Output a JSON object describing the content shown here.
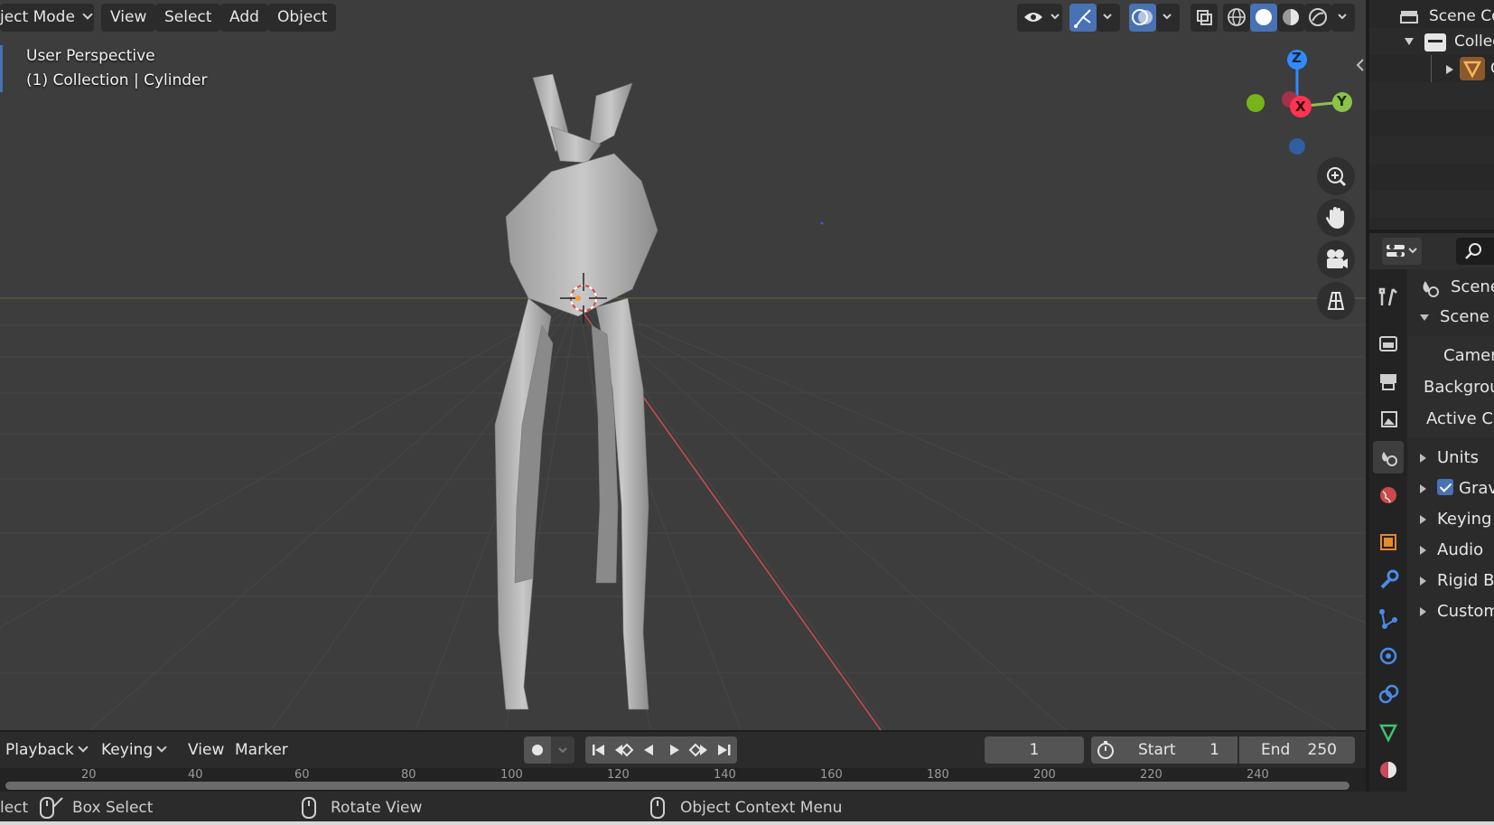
{
  "viewport_header": {
    "mode_label": "ject Mode",
    "menus": [
      "View",
      "Select",
      "Add",
      "Object"
    ]
  },
  "viewport": {
    "perspective_label": "User Perspective",
    "collection_label": "(1) Collection | Cylinder",
    "gizmo": {
      "z": "Z",
      "x": "X",
      "y": "Y"
    }
  },
  "outliner": {
    "scene_collection": "Scene Co",
    "collection": "Collec",
    "object": "C"
  },
  "properties": {
    "breadcrumb": "Scene",
    "panel_title": "Scene",
    "fields": [
      "Camer",
      "Backgrou",
      "Active Cli"
    ],
    "subpanels": [
      "Units",
      "Grav",
      "Keying",
      "Audio",
      "Rigid B",
      "Custom"
    ]
  },
  "timeline": {
    "menus": [
      "Playback",
      "Keying",
      "View",
      "Marker"
    ],
    "current_frame": "1",
    "start_label": "Start",
    "start_value": "1",
    "end_label": "End",
    "end_value": "250",
    "ticks": [
      "20",
      "40",
      "60",
      "80",
      "100",
      "120",
      "140",
      "160",
      "180",
      "200",
      "220",
      "240"
    ]
  },
  "statusbar": {
    "select": "lect",
    "box_select": "Box Select",
    "rotate_view": "Rotate View",
    "context_menu": "Object Context Menu"
  },
  "colors": {
    "accent": "#4772b3",
    "x_axis": "#ff3352",
    "y_axis": "#8bc34a",
    "z_axis": "#2f8bff"
  }
}
